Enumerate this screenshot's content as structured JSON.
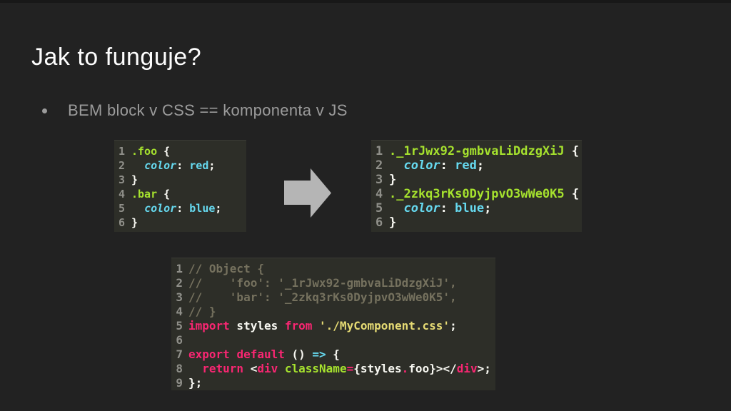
{
  "slide": {
    "title": "Jak to funguje?",
    "bullet": {
      "marker_glyph": "●",
      "text": "BEM block v CSS == komponenta v JS"
    }
  },
  "colors": {
    "slide_bg": "#222222",
    "top_strip": "#181818",
    "code_bg": "#2d2e28",
    "code_border_top": "#3b3b35",
    "line_number": "#90908a",
    "plain": "#f8f8f2",
    "green": "#a6e22e",
    "cyan": "#66d9ef",
    "pink": "#f92672",
    "yellow": "#e6db74",
    "comment": "#75715e",
    "arrow": "#b5b5b5",
    "title_text": "#fdfdfd",
    "bullet_text": "#9b9b9b"
  },
  "arrow": {
    "icon": "arrow-right-icon"
  },
  "code_blocks": [
    {
      "name": "css-source",
      "lines": [
        {
          "num": "1",
          "tokens": [
            [
              "green",
              ".foo"
            ],
            [
              "plain",
              " {"
            ]
          ]
        },
        {
          "num": "2",
          "tokens": [
            [
              "plain",
              "  "
            ],
            [
              "cyan_italic",
              "color"
            ],
            [
              "plain",
              ": "
            ],
            [
              "cyan",
              "red"
            ],
            [
              "plain",
              ";"
            ]
          ]
        },
        {
          "num": "3",
          "tokens": [
            [
              "plain",
              "}"
            ]
          ]
        },
        {
          "num": "4",
          "tokens": [
            [
              "green",
              ".bar"
            ],
            [
              "plain",
              " {"
            ]
          ]
        },
        {
          "num": "5",
          "tokens": [
            [
              "plain",
              "  "
            ],
            [
              "cyan_italic",
              "color"
            ],
            [
              "plain",
              ": "
            ],
            [
              "cyan",
              "blue"
            ],
            [
              "plain",
              ";"
            ]
          ]
        },
        {
          "num": "6",
          "tokens": [
            [
              "plain",
              "}"
            ]
          ]
        }
      ]
    },
    {
      "name": "css-modules-output",
      "lines": [
        {
          "num": "1",
          "tokens": [
            [
              "green",
              "._1rJwx92-gmbvaLiDdzgXiJ"
            ],
            [
              "plain",
              " {"
            ]
          ]
        },
        {
          "num": "2",
          "tokens": [
            [
              "plain",
              "  "
            ],
            [
              "cyan_italic",
              "color"
            ],
            [
              "plain",
              ": "
            ],
            [
              "cyan",
              "red"
            ],
            [
              "plain",
              ";"
            ]
          ]
        },
        {
          "num": "3",
          "tokens": [
            [
              "plain",
              "}"
            ]
          ]
        },
        {
          "num": "4",
          "tokens": [
            [
              "green",
              "._2zkq3rKs0DyjpvO3wWe0K5"
            ],
            [
              "plain",
              " {"
            ]
          ]
        },
        {
          "num": "5",
          "tokens": [
            [
              "plain",
              "  "
            ],
            [
              "cyan_italic",
              "color"
            ],
            [
              "plain",
              ": "
            ],
            [
              "cyan",
              "blue"
            ],
            [
              "plain",
              ";"
            ]
          ]
        },
        {
          "num": "6",
          "tokens": [
            [
              "plain",
              "}"
            ]
          ]
        }
      ]
    },
    {
      "name": "js-component",
      "lines": [
        {
          "num": "1",
          "tokens": [
            [
              "comment",
              "// Object {"
            ]
          ]
        },
        {
          "num": "2",
          "tokens": [
            [
              "comment",
              "//    'foo': '_1rJwx92-gmbvaLiDdzgXiJ',"
            ]
          ]
        },
        {
          "num": "3",
          "tokens": [
            [
              "comment",
              "//    'bar': '_2zkq3rKs0DyjpvO3wWe0K5',"
            ]
          ]
        },
        {
          "num": "4",
          "tokens": [
            [
              "comment",
              "// }"
            ]
          ]
        },
        {
          "num": "5",
          "tokens": [
            [
              "pink",
              "import"
            ],
            [
              "plain",
              " styles "
            ],
            [
              "pink",
              "from"
            ],
            [
              "plain",
              " "
            ],
            [
              "yellow",
              "'./MyComponent.css'"
            ],
            [
              "plain",
              ";"
            ]
          ]
        },
        {
          "num": "6",
          "tokens": []
        },
        {
          "num": "7",
          "tokens": [
            [
              "pink",
              "export"
            ],
            [
              "plain",
              " "
            ],
            [
              "pink",
              "default"
            ],
            [
              "plain",
              " () "
            ],
            [
              "cyan",
              "=>"
            ],
            [
              "plain",
              " {"
            ]
          ]
        },
        {
          "num": "8",
          "tokens": [
            [
              "plain",
              "  "
            ],
            [
              "pink",
              "return"
            ],
            [
              "plain",
              " <"
            ],
            [
              "pink",
              "div"
            ],
            [
              "plain",
              " "
            ],
            [
              "green",
              "className"
            ],
            [
              "pink",
              "="
            ],
            [
              "plain",
              "{styles"
            ],
            [
              "pink",
              "."
            ],
            [
              "plain",
              "foo}></"
            ],
            [
              "pink",
              "div"
            ],
            [
              "plain",
              ">;"
            ]
          ]
        },
        {
          "num": "9",
          "tokens": [
            [
              "plain",
              "};"
            ]
          ]
        }
      ]
    }
  ]
}
